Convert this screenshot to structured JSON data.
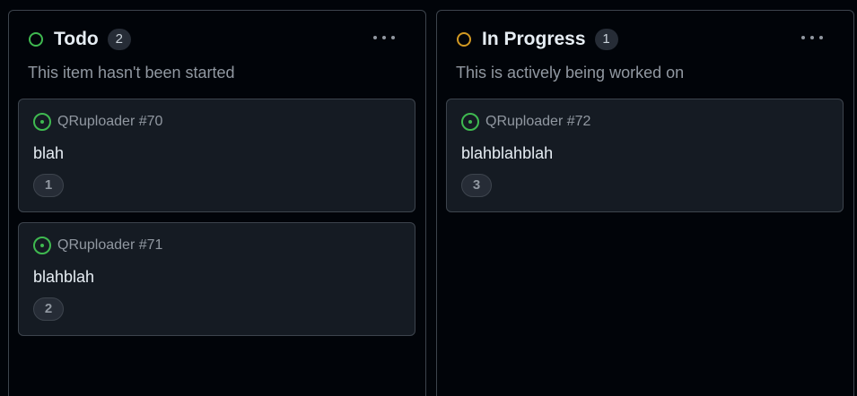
{
  "columns": [
    {
      "title": "Todo",
      "count": "2",
      "status_color": "#3fb950",
      "description": "This item hasn't been started",
      "menu_icon": "kebab-horizontal-icon",
      "cards": [
        {
          "repo_ref": "QRuploader #70",
          "title": "blah",
          "badge": "1",
          "icon": "issue-opened-icon"
        },
        {
          "repo_ref": "QRuploader #71",
          "title": "blahblah",
          "badge": "2",
          "icon": "issue-opened-icon"
        }
      ]
    },
    {
      "title": "In Progress",
      "count": "1",
      "status_color": "#d29922",
      "description": "This is actively being worked on",
      "menu_icon": "kebab-horizontal-icon",
      "cards": [
        {
          "repo_ref": "QRuploader #72",
          "title": "blahblahblah",
          "badge": "3",
          "icon": "issue-opened-icon"
        }
      ]
    }
  ]
}
